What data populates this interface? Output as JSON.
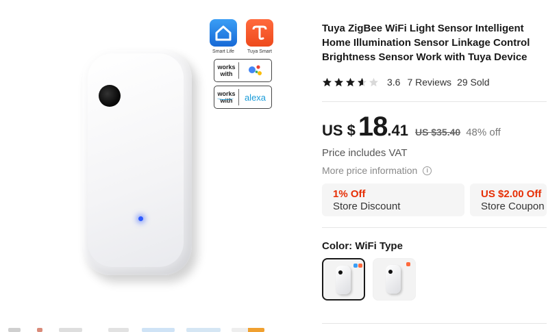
{
  "product": {
    "title": "Tuya ZigBee WiFi Light Sensor Intelligent Home Illumination Sensor Linkage Control Brightness Sensor Work with Tuya Device",
    "rating": "3.6",
    "rating_value": 3.6,
    "stars_total": 5,
    "reviews": "7 Reviews",
    "sold": "29 Sold"
  },
  "price": {
    "currency": "US $",
    "integer": "18",
    "decimal": ".41",
    "original": "US $35.40",
    "discount": "48% off",
    "vat_note": "Price includes VAT",
    "more_info": "More price information",
    "info_icon": "info-icon"
  },
  "discounts": [
    {
      "highlight": "1% Off",
      "label": "Store Discount"
    },
    {
      "highlight": "US $2.00 Off",
      "label": "Store Coupon"
    }
  ],
  "color": {
    "label": "Color: WiFi Type",
    "options_count": 2,
    "selected_index": 0
  },
  "image_badges": {
    "smart_life": "Smart Life",
    "tuya_smart": "Tuya Smart",
    "works_with": "works with",
    "alexa": "alexa"
  },
  "colors": {
    "accent_red": "#e62e04",
    "star": "#191919",
    "led_blue": "#2e5bff"
  }
}
